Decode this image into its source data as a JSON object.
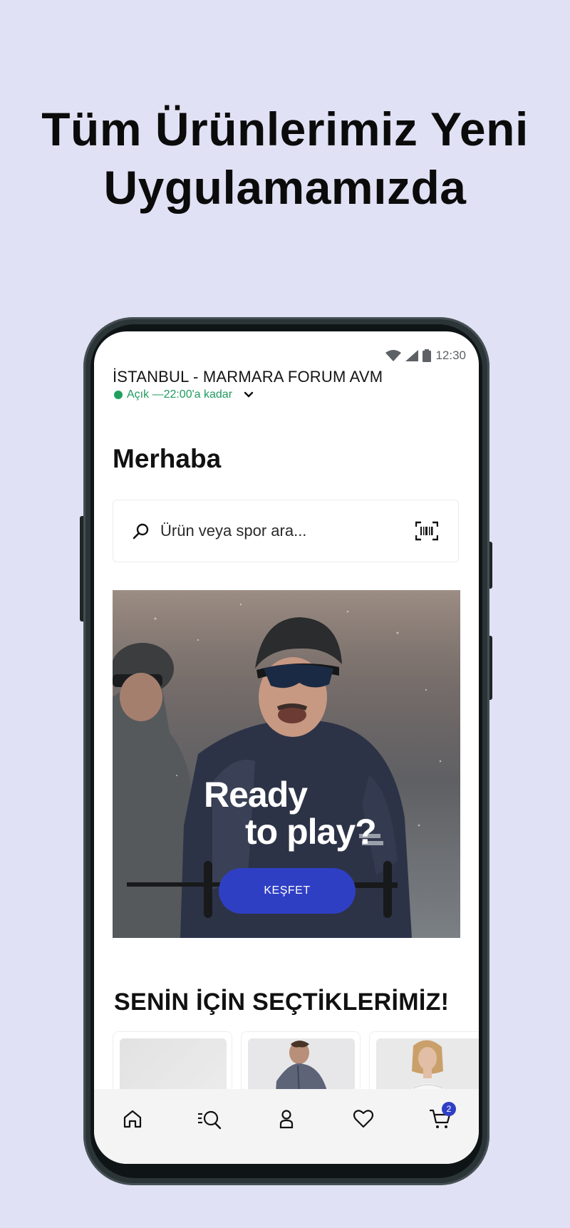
{
  "promo": {
    "headline_line1": "Tüm Ürünlerimiz Yeni",
    "headline_line2": "Uygulamamızda"
  },
  "status_bar": {
    "time": "12:30",
    "icons": [
      "wifi-icon",
      "signal-icon",
      "battery-icon"
    ]
  },
  "store": {
    "name": "İSTANBUL - MARMARA FORUM AVM",
    "status": "Açık —22:00'a kadar",
    "status_color": "#1f9a5f"
  },
  "greeting": "Merhaba",
  "search": {
    "placeholder": "Ürün veya spor ara...",
    "icons": [
      "search-icon",
      "barcode-scan-icon"
    ]
  },
  "banner": {
    "headline_line1": "Ready",
    "headline_line2": "to play?",
    "cta_label": "KEŞFET",
    "cta_color": "#2f3fc4"
  },
  "recommendations": {
    "title": "SENİN İÇİN SEÇTİKLERİMİZ!",
    "products": [
      {
        "image": "product-placeholder"
      },
      {
        "image": "jacket-model-photo"
      },
      {
        "image": "tank-top-model-photo"
      }
    ]
  },
  "bottom_nav": {
    "items": [
      {
        "icon": "home-icon"
      },
      {
        "icon": "search-list-icon"
      },
      {
        "icon": "user-icon"
      },
      {
        "icon": "heart-icon"
      },
      {
        "icon": "cart-icon",
        "badge": "2"
      }
    ],
    "accent": "#2f3fc4"
  }
}
